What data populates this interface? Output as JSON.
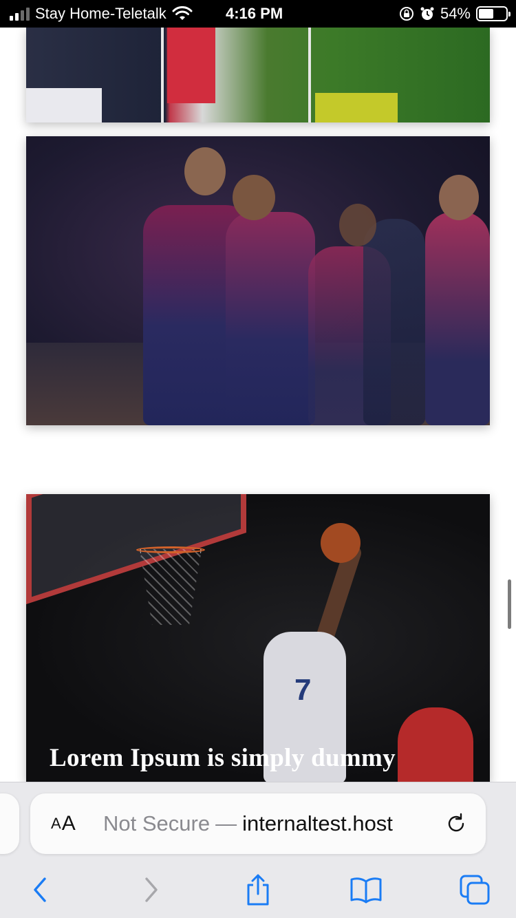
{
  "status_bar": {
    "carrier": "Stay Home-Teletalk",
    "time": "4:16 PM",
    "battery_percent": "54%",
    "battery_level": 0.54
  },
  "articles": [
    {
      "image": "football-match-photo"
    },
    {
      "image": "cricket-team-celebration-photo"
    },
    {
      "image": "basketball-dunk-photo",
      "headline": "Lorem Ipsum is simply dummy"
    }
  ],
  "browser": {
    "text_size_label_small": "A",
    "text_size_label_large": "A",
    "security_label": "Not Secure",
    "separator": "—",
    "host": "internaltest.host",
    "toolbar": {
      "back_icon": "chevron-left-icon",
      "forward_icon": "chevron-right-icon",
      "share_icon": "share-icon",
      "bookmarks_icon": "book-icon",
      "tabs_icon": "tabs-icon"
    },
    "accent_color": "#1a7cf5",
    "disabled_color": "#a7a7ab"
  }
}
